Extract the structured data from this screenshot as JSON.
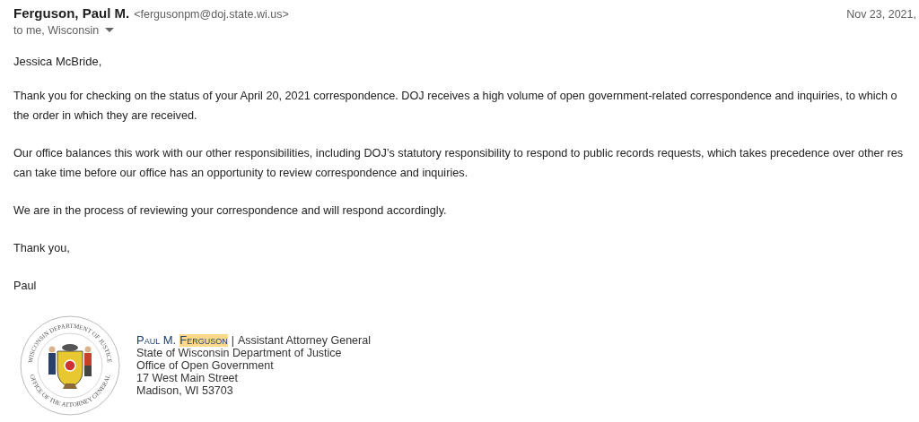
{
  "header": {
    "sender_name": "Ferguson, Paul M.",
    "sender_email": "<fergusonpm@doj.state.wi.us>",
    "recipients": "to me, Wisconsin",
    "date": "Nov 23, 2021,"
  },
  "body": {
    "greeting": "Jessica McBride,",
    "paragraphs": [
      {
        "lines": [
          "Thank you for checking on the status of your April 20, 2021 correspondence. DOJ receives a high volume of open government-related correspondence and inquiries, to which o",
          "the order in which they are received."
        ]
      },
      {
        "lines": [
          "Our office balances this work with our other responsibilities, including DOJ’s statutory responsibility to respond to public records requests, which takes precedence over other res",
          "can take time before our office has an opportunity to review correspondence and inquiries."
        ]
      },
      {
        "lines": [
          "We are in the process of reviewing your correspondence and will respond accordingly."
        ]
      },
      {
        "lines": [
          "Thank you,"
        ]
      },
      {
        "lines": [
          "Paul"
        ]
      }
    ]
  },
  "signature": {
    "seal": {
      "ring_top": "WISCONSIN DEPARTMENT OF JUSTICE",
      "ring_bottom": "OFFICE OF THE ATTORNEY GENERAL"
    },
    "name_first": "Paul M.",
    "name_highlighted": "Ferguson",
    "separator": "|",
    "title": "Assistant Attorney General",
    "lines": [
      "State of Wisconsin Department of Justice",
      "Office of Open Government",
      "17 West Main Street",
      "Madison, WI 53703"
    ]
  }
}
